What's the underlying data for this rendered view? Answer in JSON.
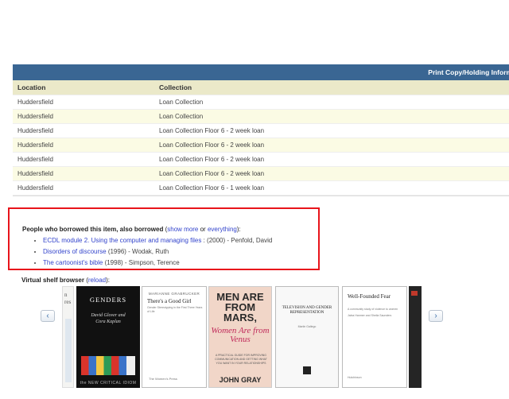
{
  "holdings": {
    "band_title": "Print Copy/Holding Informati",
    "columns": [
      "Location",
      "Collection"
    ],
    "rows": [
      {
        "location": "Huddersfield",
        "collection": "Loan Collection"
      },
      {
        "location": "Huddersfield",
        "collection": "Loan Collection"
      },
      {
        "location": "Huddersfield",
        "collection": "Loan Collection Floor 6 - 2 week loan"
      },
      {
        "location": "Huddersfield",
        "collection": "Loan Collection Floor 6 - 2 week loan"
      },
      {
        "location": "Huddersfield",
        "collection": "Loan Collection Floor 6 - 2 week loan"
      },
      {
        "location": "Huddersfield",
        "collection": "Loan Collection Floor 6 - 2 week loan"
      },
      {
        "location": "Huddersfield",
        "collection": "Loan Collection Floor 6 - 1 week loan"
      }
    ]
  },
  "also_borrowed": {
    "title": "People who borrowed this item, also borrowed",
    "paren_open": " (",
    "show_more": "show more",
    "or_text": " or ",
    "everything": "everything",
    "paren_close": "):",
    "items": [
      {
        "link": "ECDL module 2. Using the computer and managing files",
        "rest": " : (2000) - Penfold, David"
      },
      {
        "link": "Disorders of discourse",
        "rest": " (1996) - Wodak, Ruth"
      },
      {
        "link": "The cartoonist's bible",
        "rest": " (1998) - Simpson, Terence"
      }
    ]
  },
  "shelf": {
    "title": "Virtual shelf browser",
    "paren_open": " (",
    "reload": "reload",
    "paren_close": "):",
    "prev_icon": "‹",
    "next_icon": "›",
    "covers": {
      "a_text": "n\nres",
      "b_title": "GENDERS",
      "b_authors": "David Glover and\nCora Kaplan",
      "b_footer": "the NEW CRITICAL IDIOM",
      "c_author": "MARIANNE GRABRUCKER",
      "c_title": "There's a Good Girl",
      "c_sub": "Gender Stereotyping in the First Three Years of Life",
      "c_logo": "The Women's Press",
      "d_line1": "MEN ARE FROM MARS,",
      "d_line2": "Women Are from Venus",
      "d_line3": "A PRACTICAL GUIDE FOR IMPROVING COMMUNICATION AND GETTING WHAT YOU WANT IN YOUR RELATIONSHIPS",
      "d_author": "JOHN GRAY",
      "e_title": "TELEVISION AND GENDER REPRESENTATION",
      "e_author": "Martin Gallego",
      "f_title": "Well-Founded Fear",
      "f_sub": "A community study of violence to women",
      "f_authors": "Jalna Hanmer and Sheila Saunders",
      "f_footer": "Hutchinson"
    }
  }
}
